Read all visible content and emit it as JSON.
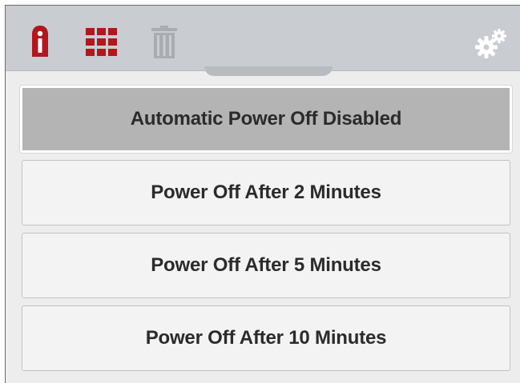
{
  "toolbar": {
    "icons": [
      "info-icon",
      "apps-grid-icon",
      "trash-icon",
      "settings-gears-icon"
    ],
    "colors": {
      "accent": "#b0171f",
      "toolbar_bg": "#c9ccd0",
      "disabled_icon": "#a9acb0",
      "settings_icon": "#ffffff"
    }
  },
  "options": [
    {
      "label": "Automatic Power Off Disabled",
      "selected": true
    },
    {
      "label": "Power Off After 2 Minutes",
      "selected": false
    },
    {
      "label": "Power Off After 5 Minutes",
      "selected": false
    },
    {
      "label": "Power Off After 10 Minutes",
      "selected": false
    }
  ]
}
